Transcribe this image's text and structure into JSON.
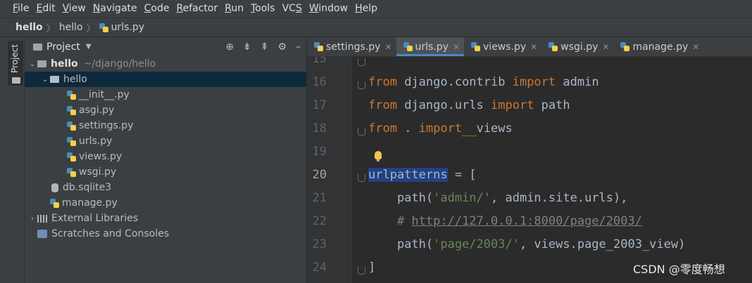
{
  "menu": {
    "items": [
      "File",
      "Edit",
      "View",
      "Navigate",
      "Code",
      "Refactor",
      "Run",
      "Tools",
      "VCS",
      "Window",
      "Help"
    ],
    "mnemonics": [
      "F",
      "E",
      "V",
      "N",
      "C",
      "R",
      "R",
      "T",
      "S",
      "W",
      "H"
    ]
  },
  "breadcrumb": {
    "items": [
      "hello",
      "hello",
      "urls.py"
    ]
  },
  "side_stripe": {
    "label": "Project"
  },
  "project": {
    "title": "Project",
    "tree": [
      {
        "name": "hello",
        "suffix": "~/django/hello",
        "level": 0,
        "kind": "folder-root",
        "expanded": true
      },
      {
        "name": "hello",
        "level": 1,
        "kind": "folder",
        "expanded": true,
        "selected": true
      },
      {
        "name": "__init__.py",
        "level": 2,
        "kind": "py"
      },
      {
        "name": "asgi.py",
        "level": 2,
        "kind": "py"
      },
      {
        "name": "settings.py",
        "level": 2,
        "kind": "py"
      },
      {
        "name": "urls.py",
        "level": 2,
        "kind": "py"
      },
      {
        "name": "views.py",
        "level": 2,
        "kind": "py"
      },
      {
        "name": "wsgi.py",
        "level": 2,
        "kind": "py"
      },
      {
        "name": "db.sqlite3",
        "level": 1,
        "kind": "db"
      },
      {
        "name": "manage.py",
        "level": 1,
        "kind": "py"
      },
      {
        "name": "External Libraries",
        "level": 0,
        "kind": "lib",
        "expanded": false
      },
      {
        "name": "Scratches and Consoles",
        "level": 0,
        "kind": "scratch"
      }
    ]
  },
  "tabs": [
    {
      "label": "settings.py",
      "active": false
    },
    {
      "label": "urls.py",
      "active": true
    },
    {
      "label": "views.py",
      "active": false
    },
    {
      "label": "wsgi.py",
      "active": false
    },
    {
      "label": "manage.py",
      "active": false
    }
  ],
  "editor": {
    "lines": [
      {
        "n": "15",
        "tokens": []
      },
      {
        "n": "16",
        "tokens": [
          [
            "kw",
            "from"
          ],
          [
            "t",
            " django.contrib "
          ],
          [
            "kw",
            "import"
          ],
          [
            "t",
            " admin"
          ]
        ]
      },
      {
        "n": "17",
        "tokens": [
          [
            "kw",
            "from"
          ],
          [
            "t",
            " django.urls "
          ],
          [
            "kw",
            "import"
          ],
          [
            "t",
            " path"
          ]
        ]
      },
      {
        "n": "18",
        "tokens": [
          [
            "kw",
            "from"
          ],
          [
            "t",
            " . "
          ],
          [
            "kw",
            "import"
          ],
          [
            "sq",
            "  "
          ],
          [
            "t",
            "views"
          ]
        ]
      },
      {
        "n": "19",
        "tokens": []
      },
      {
        "n": "20",
        "tokens": [
          [
            "hl",
            "urlpatterns"
          ],
          [
            "t",
            " = ["
          ]
        ]
      },
      {
        "n": "21",
        "tokens": [
          [
            "t",
            "    path("
          ],
          [
            "str",
            "'admin/'"
          ],
          [
            "t",
            ", admin.site.urls),"
          ]
        ]
      },
      {
        "n": "22",
        "tokens": [
          [
            "cmt",
            "    # "
          ],
          [
            "link",
            "http://127.0.0.1:8000/page/2003/"
          ]
        ]
      },
      {
        "n": "23",
        "tokens": [
          [
            "t",
            "    path("
          ],
          [
            "str",
            "'page/2003/'"
          ],
          [
            "t",
            ", views.page_2003_view)"
          ]
        ]
      },
      {
        "n": "24",
        "tokens": [
          [
            "t",
            "]"
          ]
        ]
      }
    ],
    "current_line": "20"
  },
  "watermark": "CSDN @零度畅想",
  "colors": {
    "keyword": "#cc7832",
    "string": "#6a8759",
    "comment": "#808080",
    "selection": "#214283",
    "accent": "#4a88c7"
  }
}
